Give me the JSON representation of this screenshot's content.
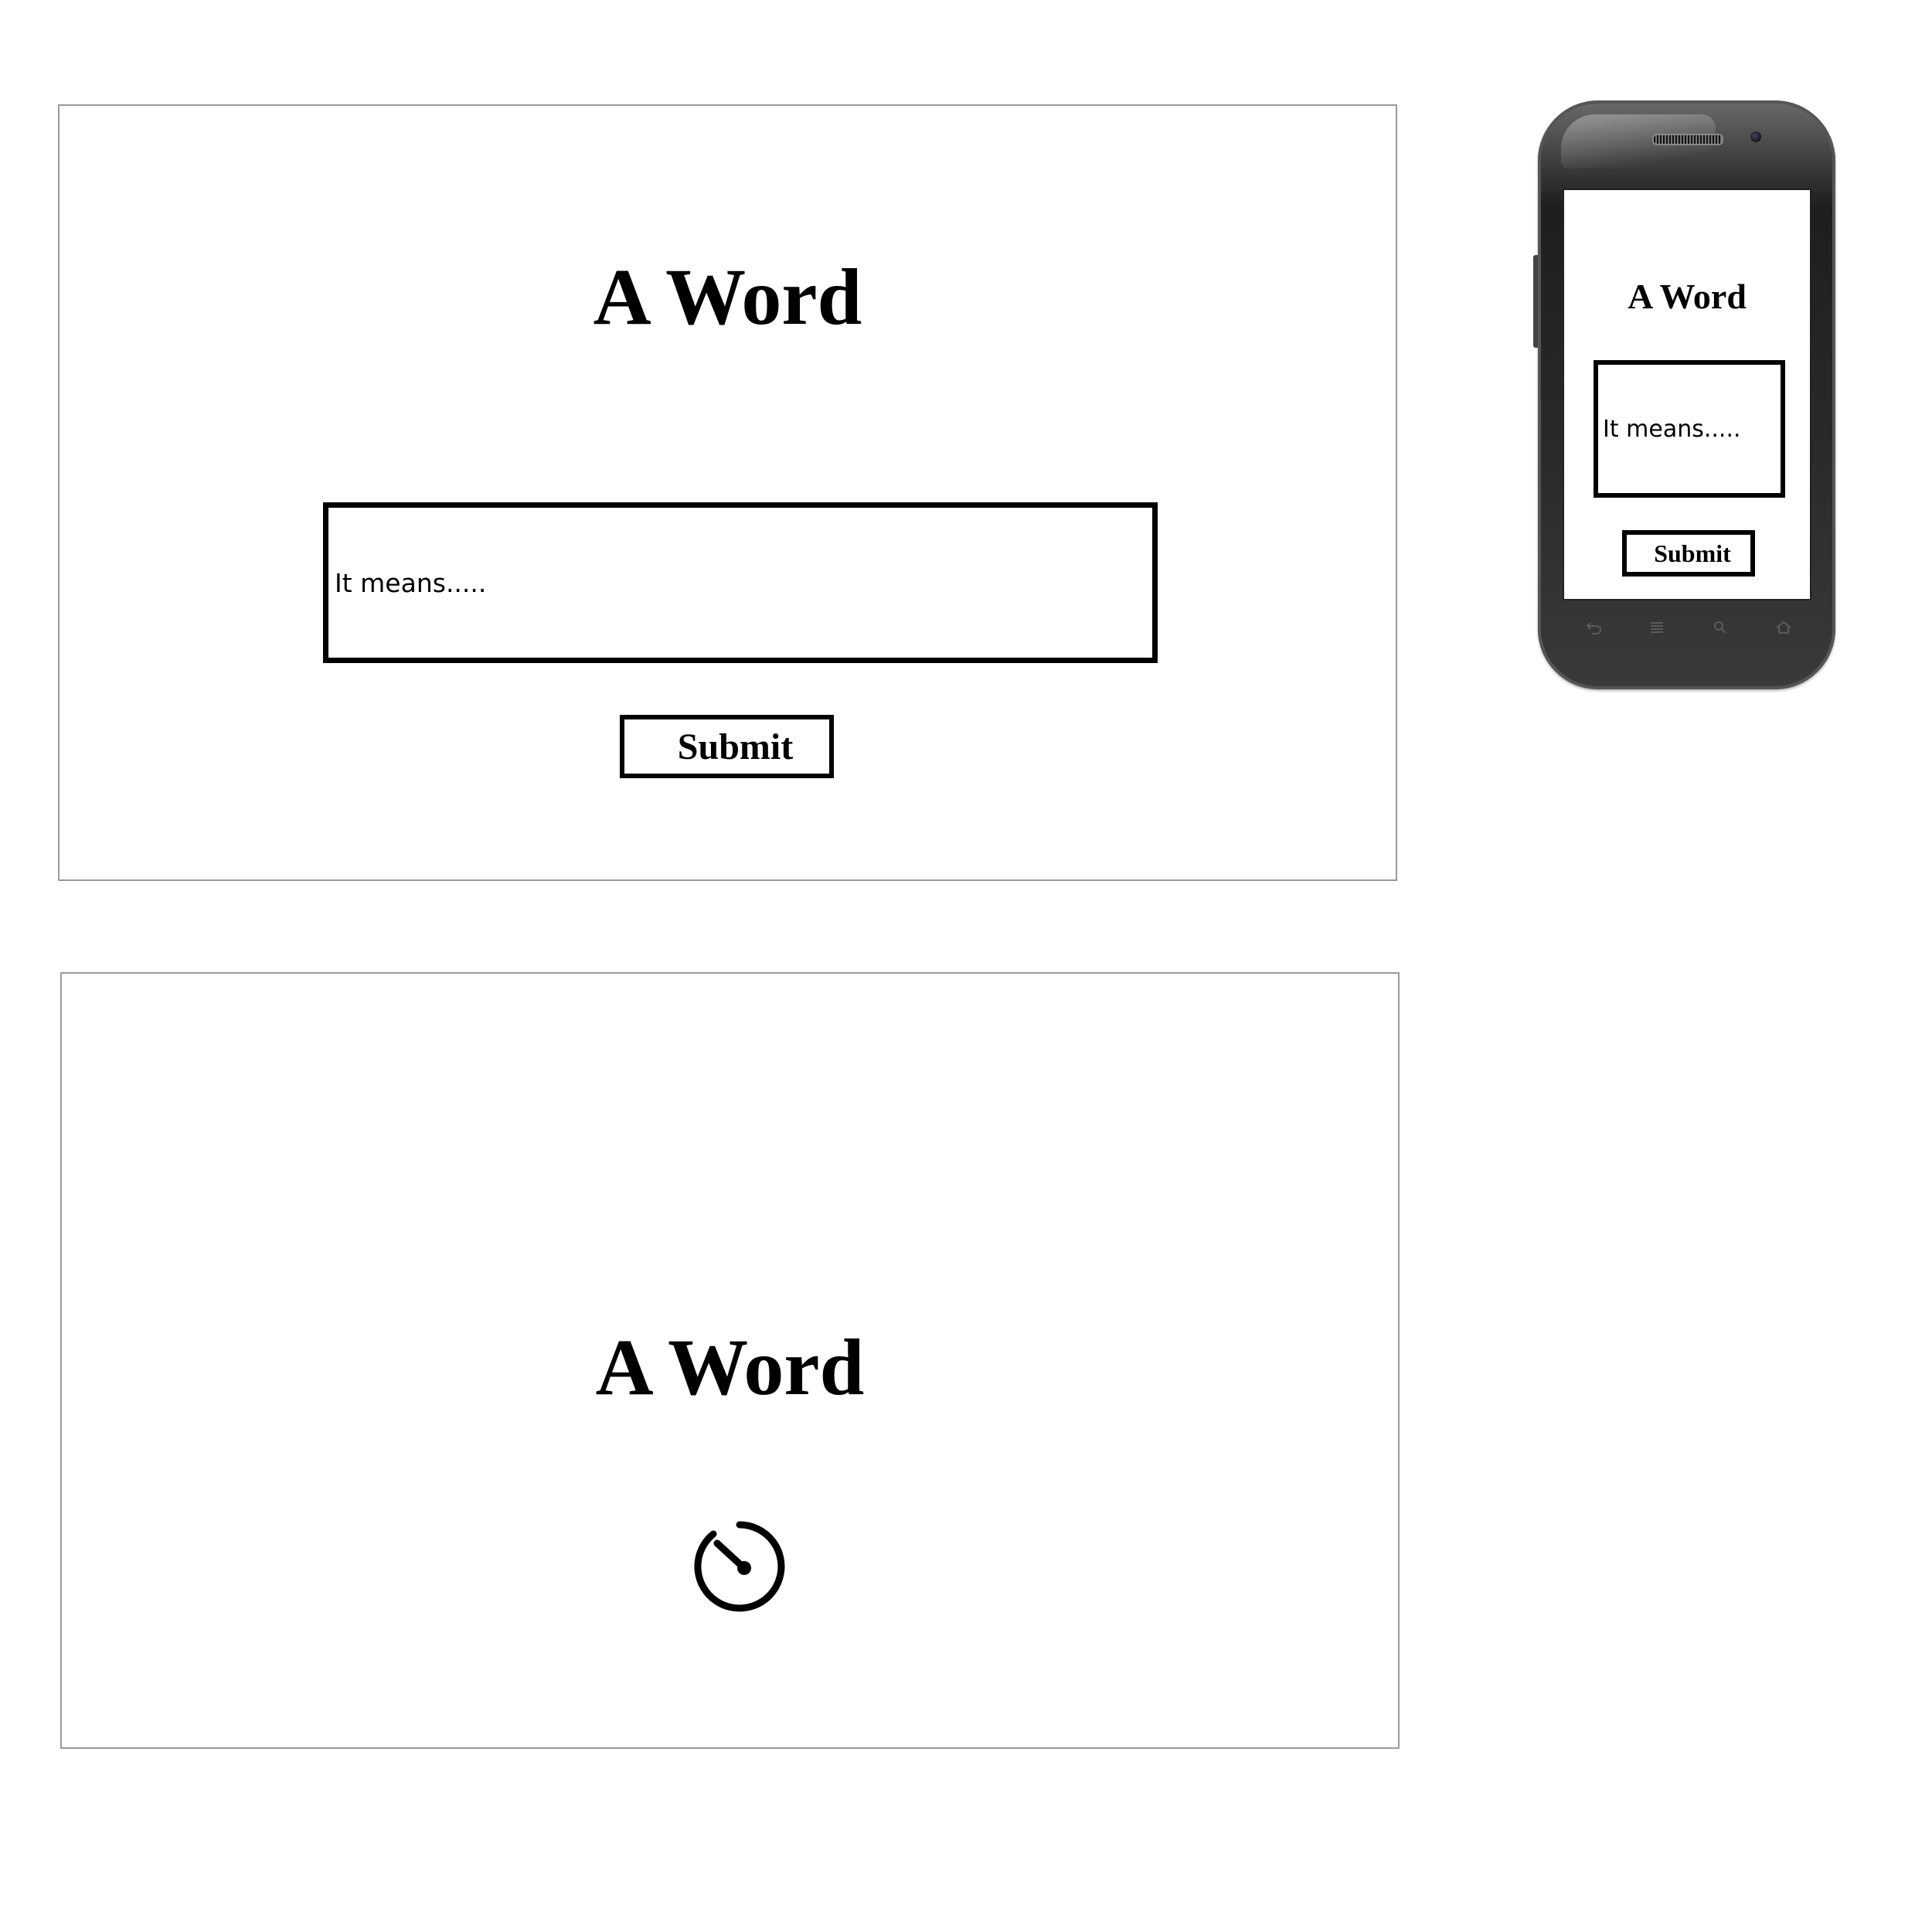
{
  "desktop": {
    "title": "A Word",
    "field_text": "It means.....",
    "submit_label": "Submit"
  },
  "mobile": {
    "title": "A Word",
    "field_text": "It means.....",
    "submit_label": "Submit",
    "nav_icons": [
      "back-icon",
      "menu-icon",
      "search-icon",
      "home-icon"
    ]
  },
  "loading": {
    "title": "A Word",
    "icon": "timer-icon"
  }
}
